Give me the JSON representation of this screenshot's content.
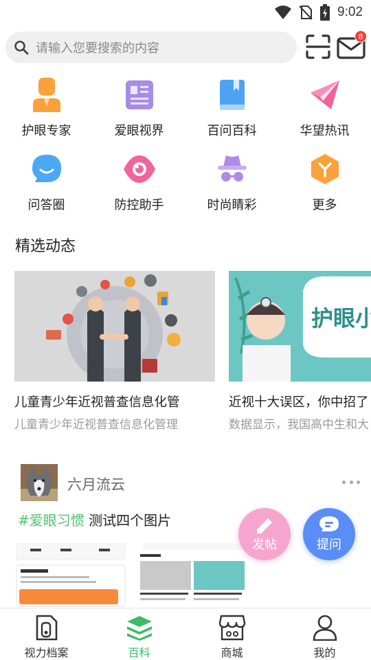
{
  "status_bar": {
    "time": "9:02"
  },
  "search": {
    "placeholder": "请输入您要搜索的内容",
    "message_badge": "8"
  },
  "grid": [
    {
      "label": "护眼专家",
      "icon": "doctor-icon",
      "color": "#f9a13a"
    },
    {
      "label": "爱眼视界",
      "icon": "article-icon",
      "color": "#a78be8"
    },
    {
      "label": "百问百科",
      "icon": "book-icon",
      "color": "#4da3f2"
    },
    {
      "label": "华望热讯",
      "icon": "send-icon",
      "color": "#f4609a"
    },
    {
      "label": "问答圈",
      "icon": "chat-bubble-icon",
      "color": "#4aa8f4"
    },
    {
      "label": "防控助手",
      "icon": "eye-icon",
      "color": "#f2649b"
    },
    {
      "label": "时尚睛彩",
      "icon": "hat-glasses-icon",
      "color": "#b08ae8"
    },
    {
      "label": "更多",
      "icon": "more-hexagon-icon",
      "color": "#f9a13a"
    }
  ],
  "section_title": "精选动态",
  "cards": [
    {
      "title": "儿童青少年近视普查信息化管",
      "subtitle": "儿童青少年近视普查信息化管理"
    },
    {
      "title": "近视十大误区，你中招了",
      "subtitle": "数据显示，我国高中生和大",
      "image_text": "护眼小贴士"
    }
  ],
  "post": {
    "user": "六月流云",
    "tag": "#爱眼习惯",
    "text": " 测试四个图片"
  },
  "fabs": {
    "post_label": "发帖",
    "ask_label": "提问"
  },
  "nav": [
    {
      "label": "视力档案",
      "icon": "file-icon"
    },
    {
      "label": "百科",
      "icon": "layers-icon",
      "active": true
    },
    {
      "label": "商城",
      "icon": "shop-icon"
    },
    {
      "label": "我的",
      "icon": "person-icon"
    }
  ],
  "colors": {
    "accent_green": "#3dbb6a",
    "tag_green": "#4fc46c",
    "badge_red": "#ff3b30"
  }
}
